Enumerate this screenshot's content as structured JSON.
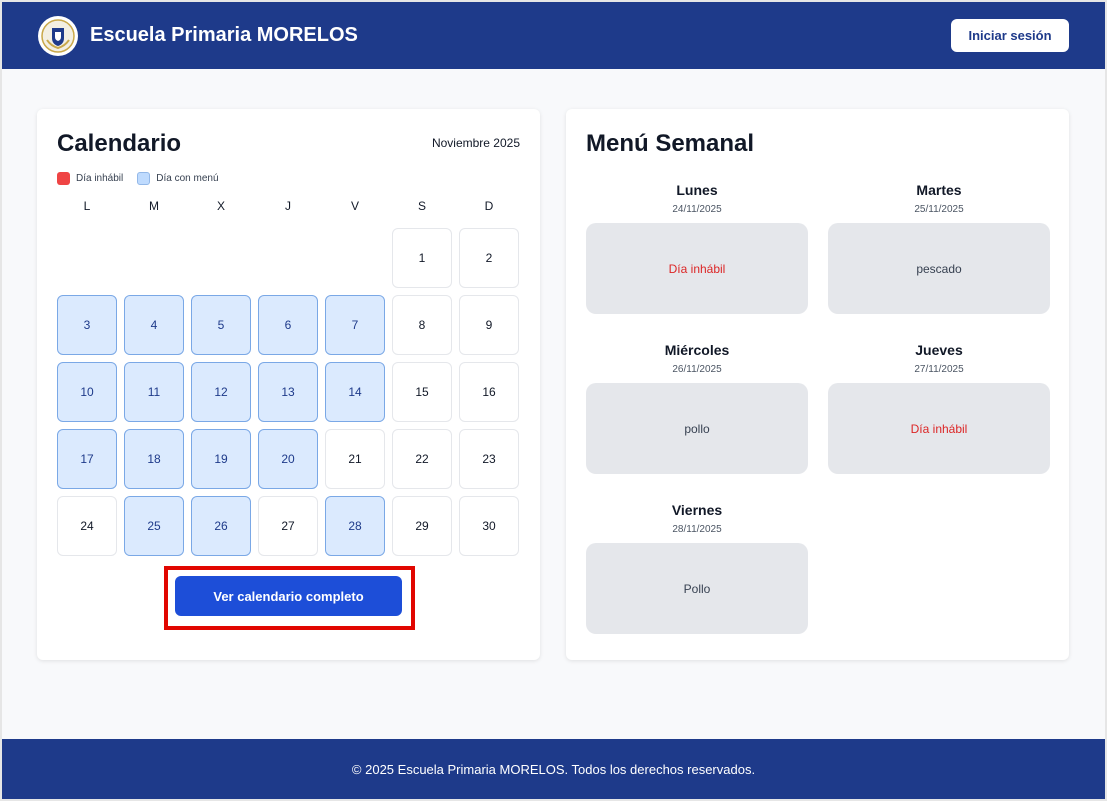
{
  "header": {
    "school_name": "Escuela Primaria MORELOS",
    "login_label": "Iniciar sesión",
    "logo_icon": "school-crest-icon"
  },
  "calendar": {
    "title": "Calendario",
    "month": "Noviembre 2025",
    "legend": {
      "holiday": "Día inhábil",
      "menu": "Día con menú"
    },
    "weekdays": [
      "L",
      "M",
      "X",
      "J",
      "V",
      "S",
      "D"
    ],
    "leading_blanks": 5,
    "days": [
      {
        "n": "1",
        "menu": false
      },
      {
        "n": "2",
        "menu": false
      },
      {
        "n": "3",
        "menu": true
      },
      {
        "n": "4",
        "menu": true
      },
      {
        "n": "5",
        "menu": true
      },
      {
        "n": "6",
        "menu": true
      },
      {
        "n": "7",
        "menu": true
      },
      {
        "n": "8",
        "menu": false
      },
      {
        "n": "9",
        "menu": false
      },
      {
        "n": "10",
        "menu": true
      },
      {
        "n": "11",
        "menu": true
      },
      {
        "n": "12",
        "menu": true
      },
      {
        "n": "13",
        "menu": true
      },
      {
        "n": "14",
        "menu": true
      },
      {
        "n": "15",
        "menu": false
      },
      {
        "n": "16",
        "menu": false
      },
      {
        "n": "17",
        "menu": true
      },
      {
        "n": "18",
        "menu": true
      },
      {
        "n": "19",
        "menu": true
      },
      {
        "n": "20",
        "menu": true
      },
      {
        "n": "21",
        "menu": false
      },
      {
        "n": "22",
        "menu": false
      },
      {
        "n": "23",
        "menu": false
      },
      {
        "n": "24",
        "menu": false
      },
      {
        "n": "25",
        "menu": true
      },
      {
        "n": "26",
        "menu": true
      },
      {
        "n": "27",
        "menu": false
      },
      {
        "n": "28",
        "menu": true
      },
      {
        "n": "29",
        "menu": false
      },
      {
        "n": "30",
        "menu": false
      }
    ],
    "view_button": "Ver calendario completo"
  },
  "menu": {
    "title": "Menú Semanal",
    "days": [
      {
        "name": "Lunes",
        "date": "24/11/2025",
        "dish": "Día inhábil",
        "off": true
      },
      {
        "name": "Martes",
        "date": "25/11/2025",
        "dish": "pescado",
        "off": false
      },
      {
        "name": "Miércoles",
        "date": "26/11/2025",
        "dish": "pollo",
        "off": false
      },
      {
        "name": "Jueves",
        "date": "27/11/2025",
        "dish": "Día inhábil",
        "off": true
      },
      {
        "name": "Viernes",
        "date": "28/11/2025",
        "dish": "Pollo",
        "off": false
      }
    ]
  },
  "footer": {
    "text": "© 2025 Escuela Primaria MORELOS. Todos los derechos reservados."
  },
  "colors": {
    "primary": "#1e3a8a",
    "button": "#1d4ed8",
    "holiday": "#ef4444",
    "menu_day": "#dbeafe",
    "highlight": "#e10600"
  }
}
